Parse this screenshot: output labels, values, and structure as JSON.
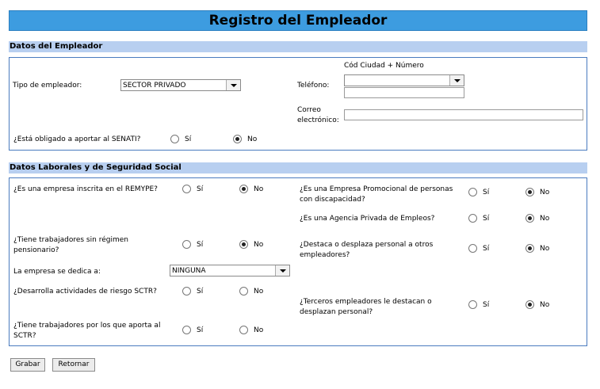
{
  "title": "Registro del Empleador",
  "datos_empleador": {
    "header": "Datos del Empleador",
    "tipo_label": "Tipo de empleador:",
    "tipo_value": "SECTOR PRIVADO",
    "cod_ciudad_label": "Cód Ciudad + Número",
    "telefono_label": "Teléfono:",
    "correo_label_1": "Correo",
    "correo_label_2": "electrónico:",
    "senati_question": "¿Está obligado a aportar al SENATI?",
    "si": "Sí",
    "no": "No"
  },
  "datos_laborales": {
    "header": "Datos Laborales y de Seguridad Social",
    "remype": "¿Es una empresa inscrita en el REMYPE?",
    "sin_regimen_1": "¿Tiene trabajadores sin régimen",
    "sin_regimen_2": "pensionario?",
    "dedica_label": "La empresa se dedica a:",
    "dedica_value": "NINGUNA",
    "sctr": "¿Desarrolla actividades de riesgo SCTR?",
    "aporta_sctr_1": "¿Tiene trabajadores por los que aporta al",
    "aporta_sctr_2": "SCTR?",
    "promocional_1": "¿Es una Empresa Promocional de personas",
    "promocional_2": "con discapacidad?",
    "agencia": "¿Es una Agencia Privada de Empleos?",
    "destaca_1": "¿Destaca o desplaza personal a otros",
    "destaca_2": "empleadores?",
    "terceros_1": "¿Terceros empleadores le destacan o",
    "terceros_2": "desplazan personal?",
    "si": "Sí",
    "no": "No"
  },
  "buttons": {
    "grabar": "Grabar",
    "retornar": "Retornar"
  }
}
